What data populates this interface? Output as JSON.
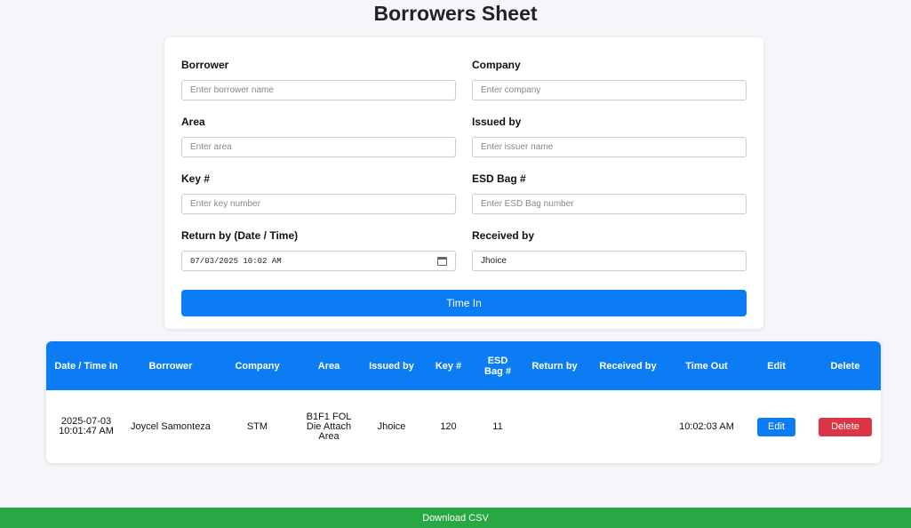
{
  "page": {
    "title": "Borrowers Sheet"
  },
  "form": {
    "borrower": {
      "label": "Borrower",
      "placeholder": "Enter borrower name",
      "value": ""
    },
    "company": {
      "label": "Company",
      "placeholder": "Enter company",
      "value": ""
    },
    "area": {
      "label": "Area",
      "placeholder": "Enter area",
      "value": ""
    },
    "issued_by": {
      "label": "Issued by",
      "placeholder": "Enter issuer name",
      "value": ""
    },
    "key": {
      "label": "Key #",
      "placeholder": "Enter key number",
      "value": ""
    },
    "esd_bag": {
      "label": "ESD Bag #",
      "placeholder": "Enter ESD Bag number",
      "value": ""
    },
    "return_by": {
      "label": "Return by (Date / Time)",
      "value": "07/03/2025 10:02 AM",
      "icon": "calendar-icon"
    },
    "received_by": {
      "label": "Received by",
      "value": "Jhoice"
    },
    "submit_label": "Time In"
  },
  "table": {
    "headers": {
      "date_time_in": "Date / Time In",
      "borrower": "Borrower",
      "company": "Company",
      "area": "Area",
      "issued_by": "Issued by",
      "key": "Key #",
      "esd_bag": "ESD Bag #",
      "return_by": "Return by",
      "received_by": "Received by",
      "time_out": "Time Out",
      "edit": "Edit",
      "delete": "Delete"
    },
    "rows": [
      {
        "date_time_in": "2025-07-03 10:01:47 AM",
        "borrower": "Joycel Samonteza",
        "company": "STM",
        "area": "B1F1 FOL Die Attach Area",
        "issued_by": "Jhoice",
        "key": "120",
        "esd_bag": "11",
        "return_by": "",
        "received_by": "",
        "time_out": "10:02:03 AM",
        "edit_label": "Edit",
        "delete_label": "Delete"
      }
    ]
  },
  "footer": {
    "download_label": "Download CSV"
  },
  "colors": {
    "primary": "#0b7cf4",
    "danger": "#dc3545",
    "success": "#28a745",
    "background": "#f4f6f9"
  }
}
